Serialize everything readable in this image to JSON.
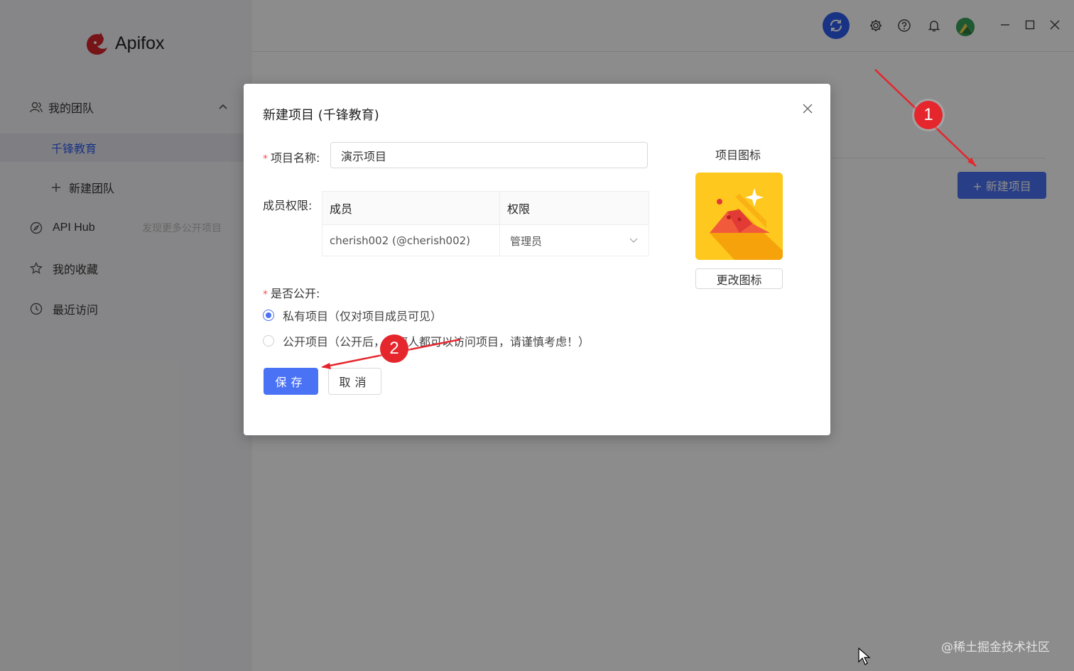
{
  "app": {
    "name": "Apifox"
  },
  "sidebar": {
    "items": [
      {
        "label": "我的团队",
        "icon": "team-icon"
      },
      {
        "label": "千锋教育"
      },
      {
        "label": "新建团队",
        "icon": "plus-icon"
      },
      {
        "label": "API Hub",
        "hint": "发现更多公开项目",
        "icon": "compass-icon"
      },
      {
        "label": "我的收藏",
        "icon": "star-icon"
      },
      {
        "label": "最近访问",
        "icon": "clock-icon"
      }
    ]
  },
  "toolbar": {
    "icons": [
      "sync-icon",
      "gear-icon",
      "help-icon",
      "bell-icon",
      "avatar"
    ]
  },
  "main": {
    "new_project_label": "+ 新建项目"
  },
  "modal": {
    "title": "新建项目 (千锋教育)",
    "name_label": "项目名称:",
    "name_value": "演示项目",
    "members_label": "成员权限:",
    "table": {
      "headers": [
        "成员",
        "权限"
      ],
      "rows": [
        {
          "member": "cherish002 (@cherish002)",
          "role": "管理员"
        }
      ]
    },
    "public_label": "是否公开:",
    "options": [
      {
        "label": "私有项目（仅对项目成员可见）",
        "selected": true
      },
      {
        "label": "公开项目（公开后，任何人都可以访问项目，请谨慎考虑！）",
        "selected": false
      }
    ],
    "save_label": "保存",
    "cancel_label": "取消",
    "icon_label": "项目图标",
    "change_icon_label": "更改图标"
  },
  "annotations": {
    "badge1": "1",
    "badge2": "2",
    "color": "#e5262d"
  },
  "watermark": "@稀土掘金技术社区",
  "colors": {
    "primary": "#4a72f5",
    "sync": "#2f5ef0",
    "required": "#ff4d4f",
    "icon_bg": "#ffc81e"
  }
}
